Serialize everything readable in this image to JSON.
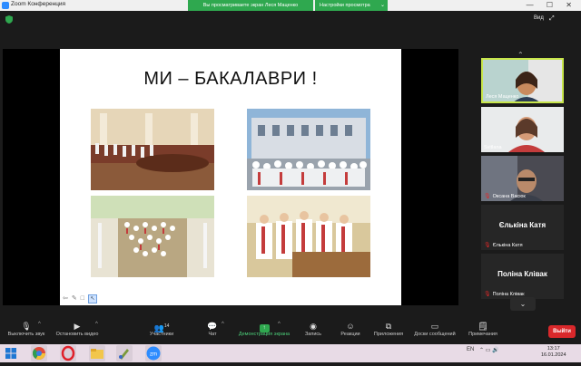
{
  "window": {
    "app_title": "Zoom Конференция",
    "share_banner": "Вы просматриваете экран Леся Маценко",
    "view_options_label": "Настройки просмотра",
    "window_controls": "— ☐ ✕"
  },
  "meeting_bar": {
    "view_label": "Вид"
  },
  "slide": {
    "title": "МИ – БАКАЛАВРИ !"
  },
  "participants": [
    {
      "name": "Леся Маценко",
      "muted": false,
      "active": true
    },
    {
      "name": "Svitlana",
      "muted": false,
      "active": false
    },
    {
      "name": "Оксана Васюк",
      "muted": true,
      "active": false
    },
    {
      "name": "Єлькіна Катя",
      "muted": true,
      "active": false,
      "display": "Єлькіна Катя"
    },
    {
      "name": "Поліна Клівак",
      "muted": true,
      "active": false,
      "display": "Поліна Клівак"
    }
  ],
  "toolbar": {
    "mute_label": "Выключить звук",
    "video_label": "Остановить видео",
    "participants_label": "Участники",
    "participants_count": "14",
    "chat_label": "Чат",
    "share_label": "Демонстрация экрана",
    "record_label": "Запись",
    "reactions_label": "Реакции",
    "apps_label": "Приложения",
    "whiteboard_label": "Доски сообщений",
    "notes_label": "Примечания",
    "leave_label": "Выйти"
  },
  "taskbar": {
    "lang": "EN",
    "time": "13:17",
    "date": "16.01.2024"
  },
  "colors": {
    "share_green": "#2fa84f",
    "leave_red": "#d9282b",
    "active_speaker": "#c8e64b"
  }
}
